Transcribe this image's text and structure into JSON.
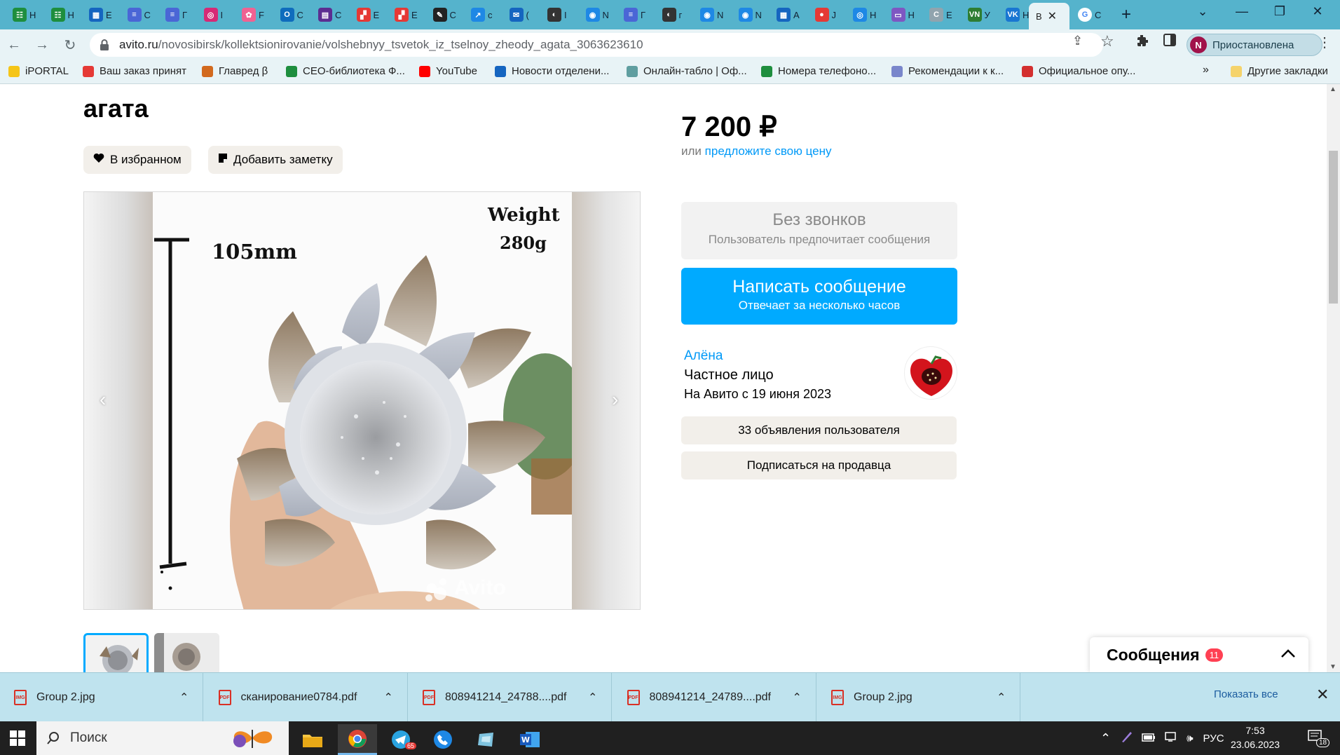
{
  "browser": {
    "tabs": [
      {
        "fav_color": "#1e8e3e",
        "fav_text": "☷",
        "title": "Н"
      },
      {
        "fav_color": "#1e8e3e",
        "fav_text": "☷",
        "title": "Н"
      },
      {
        "fav_color": "#1565c0",
        "fav_text": "▦",
        "title": "Е"
      },
      {
        "fav_color": "#4a66d6",
        "fav_text": "≡",
        "title": "С"
      },
      {
        "fav_color": "#4a66d6",
        "fav_text": "≡",
        "title": "Г"
      },
      {
        "fav_color": "#d62976",
        "fav_text": "◎",
        "title": "I"
      },
      {
        "fav_color": "#f06292",
        "fav_text": "✿",
        "title": "F"
      },
      {
        "fav_color": "#0f6cbd",
        "fav_text": "O",
        "title": "С"
      },
      {
        "fav_color": "#5c2d91",
        "fav_text": "▤",
        "title": "С"
      },
      {
        "fav_color": "#e53935",
        "fav_text": "▞",
        "title": "Е"
      },
      {
        "fav_color": "#e53935",
        "fav_text": "▞",
        "title": "Е"
      },
      {
        "fav_color": "#222222",
        "fav_text": "✎",
        "title": "С"
      },
      {
        "fav_color": "#1e88e5",
        "fav_text": "↗",
        "title": "с"
      },
      {
        "fav_color": "#1565c0",
        "fav_text": "✉",
        "title": "("
      },
      {
        "fav_color": "#333333",
        "fav_text": "◐",
        "title": "I"
      },
      {
        "fav_color": "#1e88e5",
        "fav_text": "◉",
        "title": "N"
      },
      {
        "fav_color": "#4a66d6",
        "fav_text": "≡",
        "title": "Г"
      },
      {
        "fav_color": "#333333",
        "fav_text": "◐",
        "title": "г"
      },
      {
        "fav_color": "#1e88e5",
        "fav_text": "◉",
        "title": "N"
      },
      {
        "fav_color": "#1e88e5",
        "fav_text": "◉",
        "title": "N"
      },
      {
        "fav_color": "#1565c0",
        "fav_text": "▦",
        "title": "А"
      },
      {
        "fav_color": "#e53935",
        "fav_text": "●",
        "title": "J"
      },
      {
        "fav_color": "#1e88e5",
        "fav_text": "◎",
        "title": "Н"
      },
      {
        "fav_color": "#7e57c2",
        "fav_text": "▭",
        "title": "Н"
      },
      {
        "fav_color": "#90a4ae",
        "fav_text": "C",
        "title": "Е"
      },
      {
        "fav_color": "#2e7d32",
        "fav_text": "VN",
        "title": "У"
      },
      {
        "fav_color": "#1976d2",
        "fav_text": "VK",
        "title": "Н"
      }
    ],
    "active_tab_title": "В",
    "google_tab_title": "С",
    "url_host": "avito.ru",
    "url_path": "/novosibirsk/kollektsionirovanie/volshebnyy_tsvetok_iz_tselnoy_zheody_agata_3063623610",
    "profile_label": "Приостановлена",
    "profile_initial": "N",
    "bookmarks": [
      {
        "label": "iPORTAL",
        "color": "#f5c518"
      },
      {
        "label": "Ваш заказ принят",
        "color": "#e53935"
      },
      {
        "label": "Главред β",
        "color": "#d2691e"
      },
      {
        "label": "СЕО-библиотека Ф...",
        "color": "#1e8e3e"
      },
      {
        "label": "YouTube",
        "color": "#ff0000"
      },
      {
        "label": "Новости отделени...",
        "color": "#1565c0"
      },
      {
        "label": "Онлайн-табло | Оф...",
        "color": "#5f9ea0"
      },
      {
        "label": "Номера телефоно...",
        "color": "#1e8e3e"
      },
      {
        "label": "Рекомендации к к...",
        "color": "#7986cb"
      },
      {
        "label": "Официальное опу...",
        "color": "#d32f2f"
      }
    ],
    "bookmarks_more": "»",
    "other_bookmarks": "Другие закладки"
  },
  "listing": {
    "title_tail": "агата",
    "favorite_label": "В избранном",
    "note_label": "Добавить заметку",
    "photo": {
      "weight_label": "Weight",
      "weight_value": "280g",
      "height_label": "105mm",
      "watermark": "Avito"
    },
    "price": "7 200 ₽",
    "offer_prefix": "или",
    "offer_link": "предложите свою цену",
    "no_calls_title": "Без звонков",
    "no_calls_sub": "Пользователь предпочитает сообщения",
    "message_button": "Написать сообщение",
    "message_button_sub": "Отвечает за несколько часов",
    "seller": {
      "name": "Алёна",
      "type": "Частное лицо",
      "since": "На Авито с 19 июня 2023"
    },
    "ads_button": "33 объявления пользователя",
    "subscribe_button": "Подписаться на продавца"
  },
  "messenger": {
    "label": "Сообщения",
    "count": "11"
  },
  "downloads": {
    "items": [
      {
        "name": "Group 2.jpg",
        "kind": "IMG"
      },
      {
        "name": "сканирование0784.pdf",
        "kind": "PDF"
      },
      {
        "name": "808941214_24788....pdf",
        "kind": "PDF"
      },
      {
        "name": "808941214_24789....pdf",
        "kind": "PDF"
      },
      {
        "name": "Group 2.jpg",
        "kind": "IMG"
      }
    ],
    "show_all": "Показать все"
  },
  "taskbar": {
    "search_placeholder": "Поиск",
    "language": "РУС",
    "time": "7:53",
    "date": "23.06.2023",
    "notifications": "18",
    "telegram_badge": "65"
  },
  "colors": {
    "tabstrip": "#55b3cc",
    "avito_blue": "#00aaff",
    "link_blue": "#0099f7"
  }
}
